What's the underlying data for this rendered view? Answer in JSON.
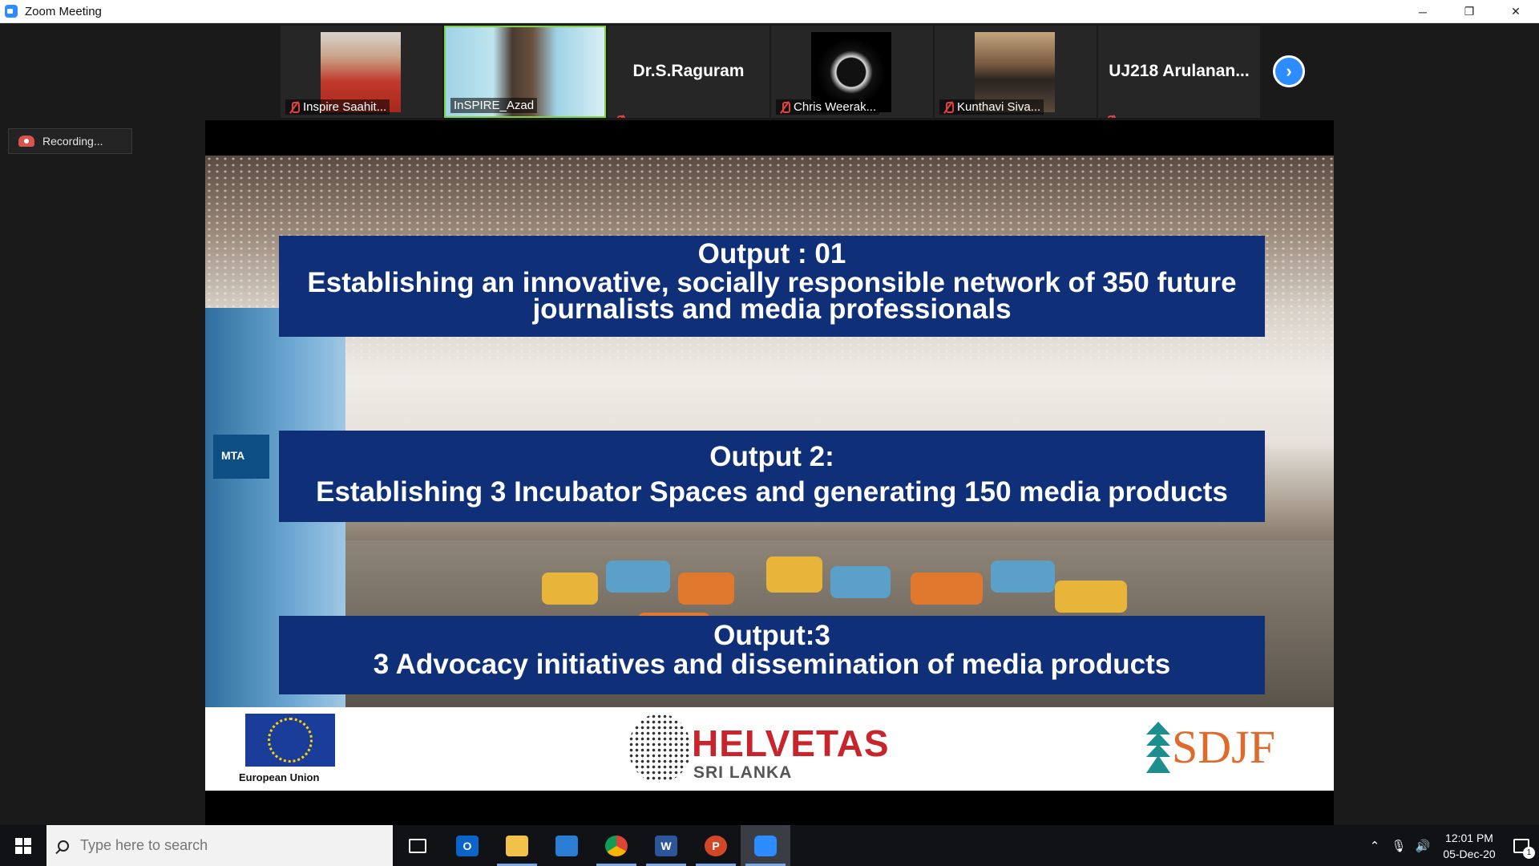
{
  "window": {
    "title": "Zoom Meeting",
    "controls": {
      "minimize": "─",
      "restore": "❐",
      "close": "✕"
    }
  },
  "recording": {
    "label": "Recording..."
  },
  "participants": [
    {
      "name": "Inspire Saahit...",
      "type": "video",
      "muted": true
    },
    {
      "name": "InSPIRE_Azad",
      "type": "video",
      "muted": false,
      "active_speaker": true
    },
    {
      "name": "Dr.S.Raguram",
      "type": "name-only",
      "muted": true
    },
    {
      "name": "Chris Weerak...",
      "type": "video",
      "muted": true
    },
    {
      "name": "Kunthavi Siva...",
      "type": "video",
      "muted": true
    },
    {
      "name": "UJ218  Arulanan...",
      "type": "name-only",
      "muted": true
    }
  ],
  "slide": {
    "output1_title": "Output : 01",
    "output1_text_line1": "Establishing an innovative, socially responsible network of 350 future",
    "output1_text_line2": "journalists and  media professionals",
    "output2_title": "Output 2:",
    "output2_text": "Establishing 3 Incubator Spaces and generating 150  media products",
    "output3_title": "Output:3",
    "output3_text": "3 Advocacy initiatives and dissemination of media products",
    "sign_text": "MTA",
    "logos": {
      "eu_label": "European Union",
      "helvetas": "HELVETAS",
      "helvetas_sub": "SRI LANKA",
      "sdjf": "SDJF"
    }
  },
  "taskbar": {
    "search_placeholder": "Type here to search",
    "apps": [
      {
        "name": "task-view",
        "label": "",
        "open": false
      },
      {
        "name": "outlook",
        "label": "O",
        "color": "#0a64c9",
        "open": false
      },
      {
        "name": "file-explorer",
        "label": "",
        "color": "#f2c14a",
        "open": true
      },
      {
        "name": "mail",
        "label": "",
        "color": "#2b7cd3",
        "open": false
      },
      {
        "name": "chrome",
        "label": "",
        "color": "#db4437",
        "open": true
      },
      {
        "name": "word",
        "label": "W",
        "color": "#2b579a",
        "open": true
      },
      {
        "name": "powerpoint",
        "label": "P",
        "color": "#d24726",
        "open": true
      },
      {
        "name": "zoom",
        "label": "",
        "color": "#2d8cff",
        "open": true
      }
    ],
    "time": "12:01 PM",
    "date": "05-Dec-20",
    "notification_count": "1"
  },
  "colors": {
    "banner": "#0f2f78",
    "zoom_blue": "#2d8cff",
    "helvetas_red": "#c8242b",
    "sdjf_orange": "#e06a2a"
  }
}
